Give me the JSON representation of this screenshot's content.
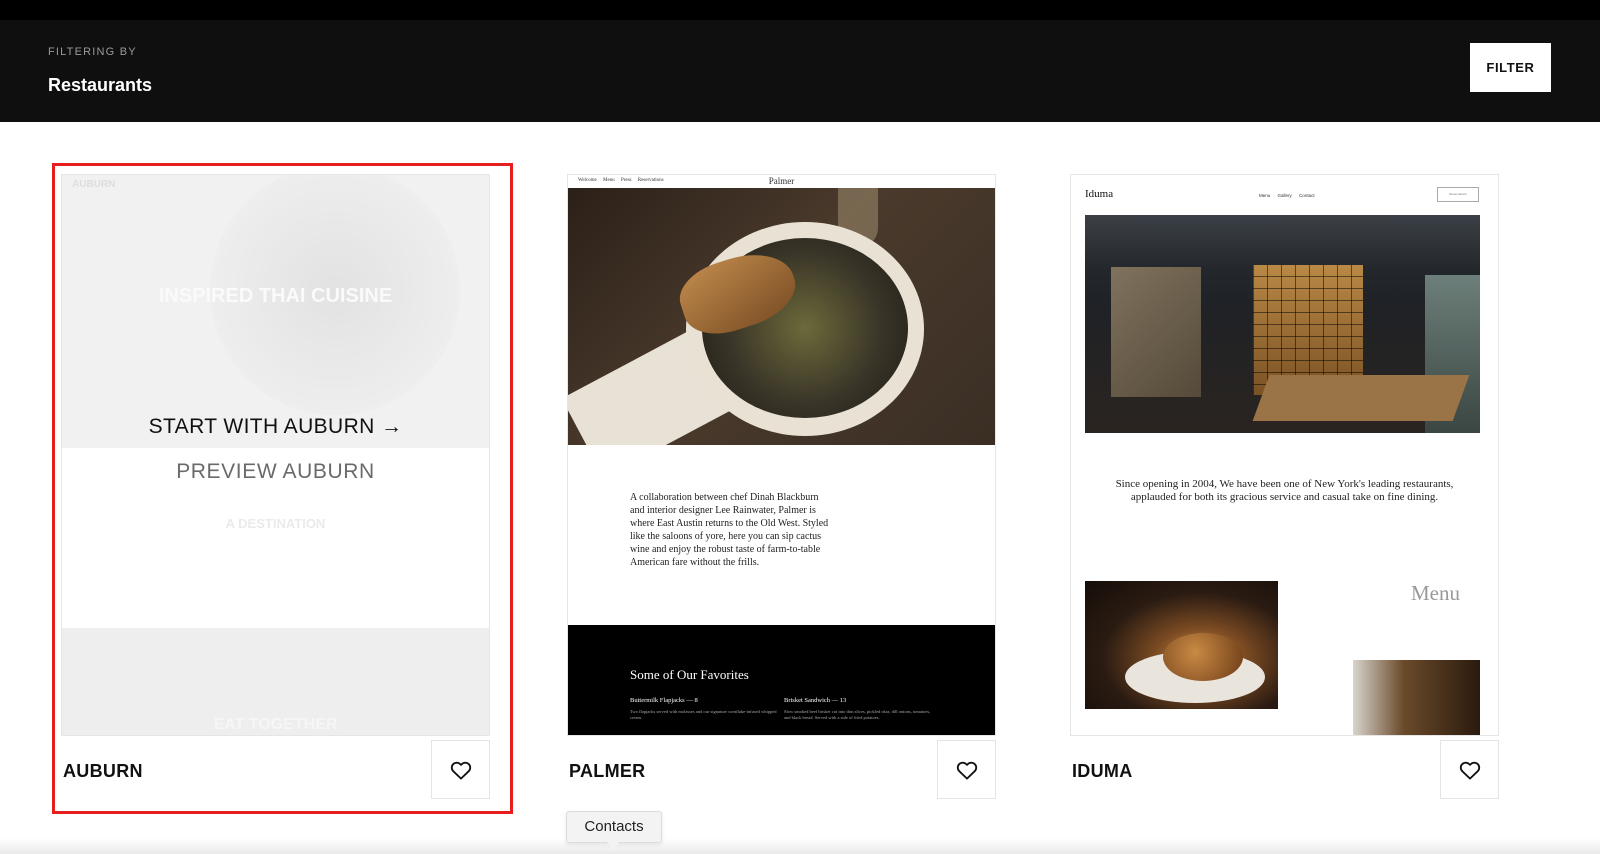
{
  "header": {
    "filter_kicker": "FILTERING BY",
    "filter_value": "Restaurants",
    "filter_button": "FILTER"
  },
  "templates": [
    {
      "name": "AUBURN",
      "start_label": "START WITH AUBURN →",
      "preview_label": "PREVIEW AUBURN",
      "preview": {
        "brand": "AUBURN",
        "headline": "INSPIRED THAI CUISINE",
        "subhead": "A DESTINATION",
        "footer": "EAT TOGETHER"
      }
    },
    {
      "name": "PALMER",
      "preview": {
        "nav_links": [
          "Welcome",
          "Menu",
          "Press",
          "Reservations"
        ],
        "logo": "Palmer",
        "body": "A collaboration between chef Dinah Blackburn and interior designer Lee Rainwater, Palmer is where East Austin returns to the Old West. Styled like the saloons of yore, here you can sip cactus wine and enjoy the robust taste of farm-to-table American fare without the frills.",
        "favorites_title": "Some of Our Favorites",
        "favorites": [
          {
            "name": "Buttermilk Flapjacks — 8",
            "desc": "Two flapjacks served with molasses and our signature cornflake-infused whipped cream."
          },
          {
            "name": "Brisket Sandwich — 13",
            "desc": "Slow smoked beef brisket cut into thin slices, pickled okra, dill onions, tomatoes, and black bread. Served with a side of fried potatoes."
          }
        ]
      }
    },
    {
      "name": "IDUMA",
      "preview": {
        "logo": "Iduma",
        "nav_links": [
          "Menu",
          "Gallery",
          "Contact"
        ],
        "nav_button": "Reservations",
        "body": "Since opening in 2004, We have been one of New York's leading restaurants, applauded for both its gracious service and casual take on fine dining.",
        "menu_label": "Menu"
      }
    }
  ],
  "tooltip": "Contacts",
  "colors": {
    "header_bg": "#0f0f0f",
    "highlight_border": "#e61e1e"
  },
  "icons": {
    "favorite": "heart-outline-icon"
  }
}
